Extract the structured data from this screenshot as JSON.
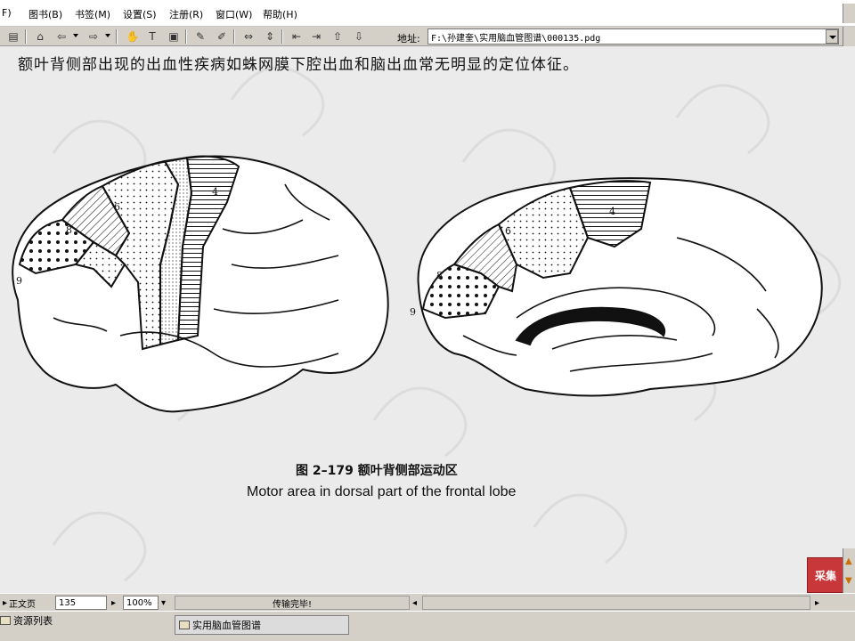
{
  "menubar": {
    "items": [
      "F)",
      "图书(B)",
      "书签(M)",
      "设置(S)",
      "注册(R)",
      "窗口(W)",
      "帮助(H)"
    ]
  },
  "toolbar": {
    "address_label": "地址:",
    "address_value": "F:\\孙建奎\\实用脑血管图谱\\000135.pdg"
  },
  "document": {
    "body_text": "额叶背侧部出现的出血性疾病如蛛网膜下腔出血和脑出血常无明显的定位体征。",
    "figure": {
      "lateral_labels": [
        "9",
        "8",
        "6",
        "4"
      ],
      "medial_labels": [
        "9",
        "8",
        "6",
        "4"
      ],
      "caption_cn": "图 2–179   额叶背侧部运动区",
      "caption_en": "Motor area in dorsal part of the frontal lobe"
    },
    "logo_text": "采集"
  },
  "statusbar": {
    "page_mode": "正文页",
    "page_number": "135",
    "zoom": "100%",
    "status": "传输完毕!"
  },
  "taskbar": {
    "resource_list": "资源列表",
    "window_title": "实用脑血管图谱"
  },
  "colors": {
    "window_bg": "#d4d0c8",
    "document_bg": "#ebebeb",
    "logo_red": "#c8383a"
  }
}
